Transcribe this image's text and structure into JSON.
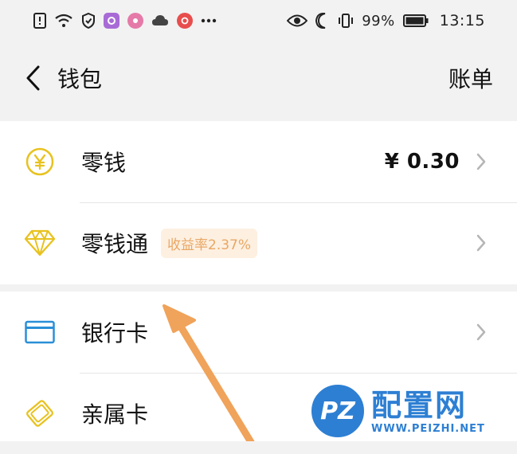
{
  "status_bar": {
    "battery": "99%",
    "time": "13:15"
  },
  "header": {
    "title": "钱包",
    "bill": "账单"
  },
  "rows": [
    {
      "label": "零钱",
      "value": "¥ 0.30",
      "icon": "yen-coin-icon"
    },
    {
      "label": "零钱通",
      "badge": "收益率2.37%",
      "icon": "diamond-icon"
    },
    {
      "label": "银行卡",
      "icon": "bank-card-icon"
    },
    {
      "label": "亲属卡",
      "icon": "family-card-icon"
    }
  ],
  "watermark": {
    "logo": "PZ",
    "title": "配置网",
    "url": "WWW.PEIZHI.NET"
  },
  "colors": {
    "accent_gold": "#e8c21f",
    "card_blue": "#2a8fd8",
    "badge_bg": "#fdf0e1",
    "badge_text": "#e9a765",
    "arrow": "#f0a35a",
    "watermark": "#2d7fd3"
  }
}
